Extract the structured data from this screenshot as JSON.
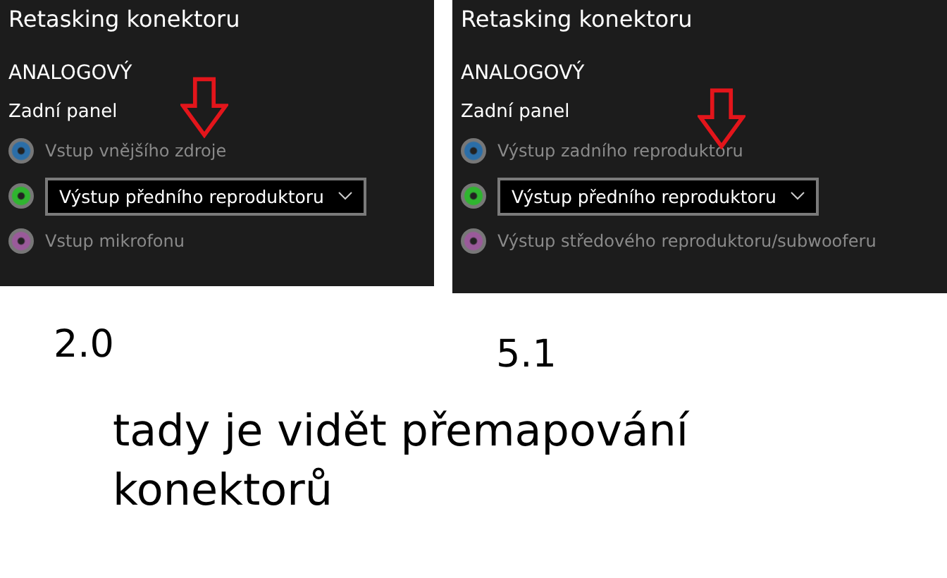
{
  "panels": [
    {
      "title": "Retasking konektoru",
      "section": "ANALOGOVÝ",
      "group": "Zadní panel",
      "caption": "2.0",
      "jacks": [
        {
          "kind": "label",
          "color": "#2b6ea8",
          "text": "Vstup vnějšího zdroje"
        },
        {
          "kind": "dropdown",
          "color": "#2fb52f",
          "text": "Výstup předního reproduktoru"
        },
        {
          "kind": "label",
          "color": "#9a5a9a",
          "text": "Vstup mikrofonu"
        }
      ]
    },
    {
      "title": "Retasking konektoru",
      "section": "ANALOGOVÝ",
      "group": "Zadní panel",
      "caption": "5.1",
      "jacks": [
        {
          "kind": "label",
          "color": "#2b6ea8",
          "text": "Výstup zadního reproduktoru"
        },
        {
          "kind": "dropdown",
          "color": "#2fb52f",
          "text": "Výstup předního reproduktoru"
        },
        {
          "kind": "label",
          "color": "#9a5a9a",
          "text": "Výstup středového reproduktoru/subwooferu"
        }
      ]
    }
  ],
  "note": "tady je vidět přemapování konektorů"
}
